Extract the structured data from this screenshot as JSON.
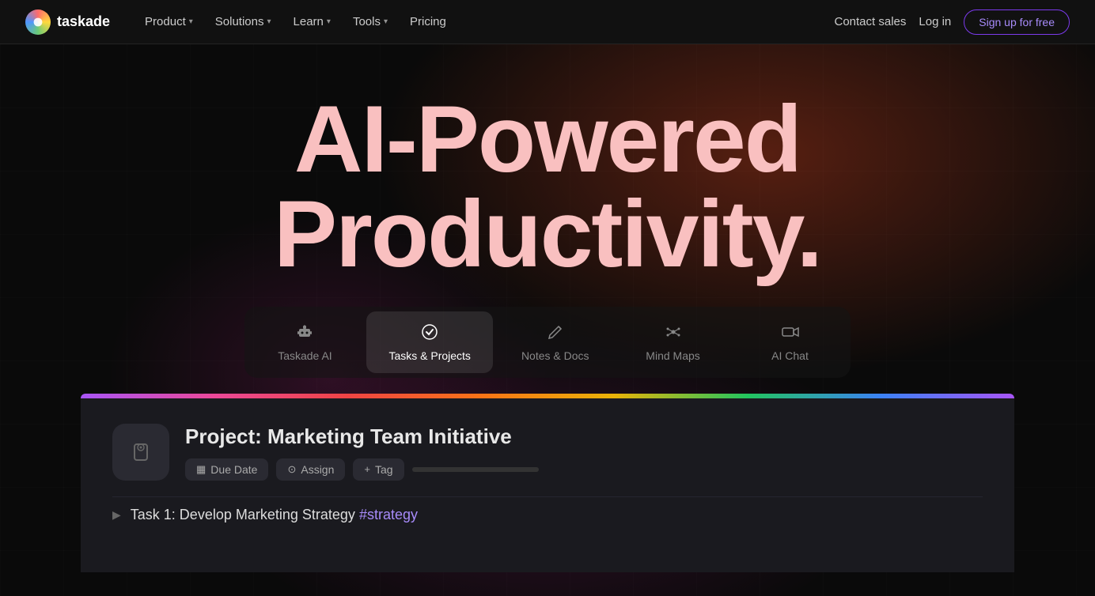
{
  "nav": {
    "logo_text": "taskade",
    "items": [
      {
        "label": "Product",
        "has_dropdown": true
      },
      {
        "label": "Solutions",
        "has_dropdown": true
      },
      {
        "label": "Learn",
        "has_dropdown": true
      },
      {
        "label": "Tools",
        "has_dropdown": true
      },
      {
        "label": "Pricing",
        "has_dropdown": false
      }
    ],
    "contact_label": "Contact sales",
    "login_label": "Log in",
    "signup_label": "Sign up for free"
  },
  "hero": {
    "title_line1": "AI-Powered",
    "title_line2": "Productivity."
  },
  "feature_tabs": [
    {
      "id": "taskade-ai",
      "label": "Taskade AI",
      "icon": "🤖",
      "active": false
    },
    {
      "id": "tasks-projects",
      "label": "Tasks & Projects",
      "icon": "✓",
      "active": true
    },
    {
      "id": "notes-docs",
      "label": "Notes & Docs",
      "icon": "✏️",
      "active": false
    },
    {
      "id": "mind-maps",
      "label": "Mind Maps",
      "icon": "⬡",
      "active": false
    },
    {
      "id": "ai-chat",
      "label": "AI Chat",
      "icon": "📹",
      "active": false
    }
  ],
  "app_preview": {
    "project": {
      "title": "Project: Marketing Team Initiative",
      "due_date_label": "Due Date",
      "assign_label": "Assign",
      "tag_label": "Tag"
    },
    "task1": {
      "text": "Task 1: Develop Marketing Strategy",
      "hashtag": "#strategy"
    }
  }
}
